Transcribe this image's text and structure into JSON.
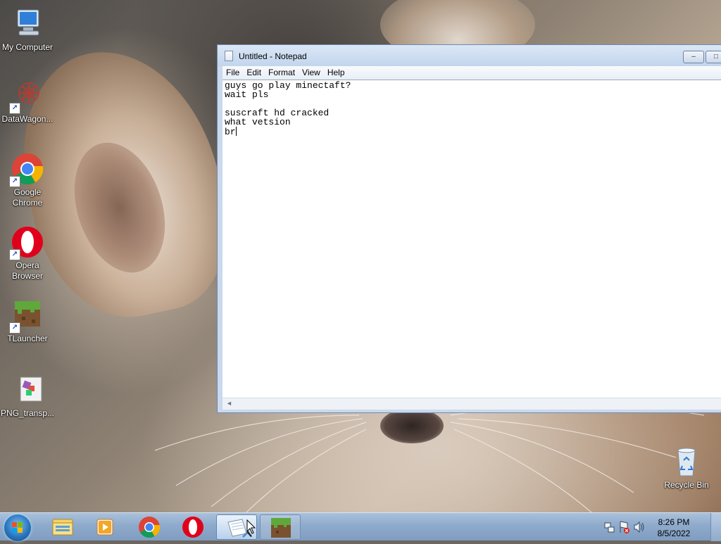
{
  "desktop": {
    "icons": [
      {
        "label": "My Computer",
        "icon": "computer-icon"
      },
      {
        "label": "DataWagon...",
        "icon": "datawagon-icon"
      },
      {
        "label": "Google Chrome",
        "icon": "chrome-icon"
      },
      {
        "label": "Opera Browser",
        "icon": "opera-icon"
      },
      {
        "label": "TLauncher",
        "icon": "tlauncher-icon"
      },
      {
        "label": "PNG_transp...",
        "icon": "png-file-icon"
      },
      {
        "label": "Recycle Bin",
        "icon": "recycle-bin-icon"
      }
    ]
  },
  "notepad": {
    "title": "Untitled - Notepad",
    "menu": [
      "File",
      "Edit",
      "Format",
      "View",
      "Help"
    ],
    "lines": [
      "guys go play minectaft?",
      "wait pls",
      "",
      "suscraft hd cracked",
      "what vetsion",
      "br"
    ],
    "buttons": {
      "minimize": "‒",
      "maximize": "□"
    }
  },
  "taskbar": {
    "start": "start-button",
    "pinned": [
      "explorer-icon",
      "media-player-icon",
      "chrome-icon",
      "opera-icon",
      "notepad-icon",
      "tlauncher-icon"
    ],
    "clock": {
      "time": "8:26 PM",
      "date": "8/5/2022"
    }
  },
  "colors": {
    "taskbar": "#8eaacb",
    "window_frame": "#c9d9ee",
    "chrome_red": "#db4437",
    "chrome_green": "#0f9d58",
    "chrome_yellow": "#f4b400",
    "chrome_blue": "#4285f4",
    "opera_red": "#e0001b"
  }
}
